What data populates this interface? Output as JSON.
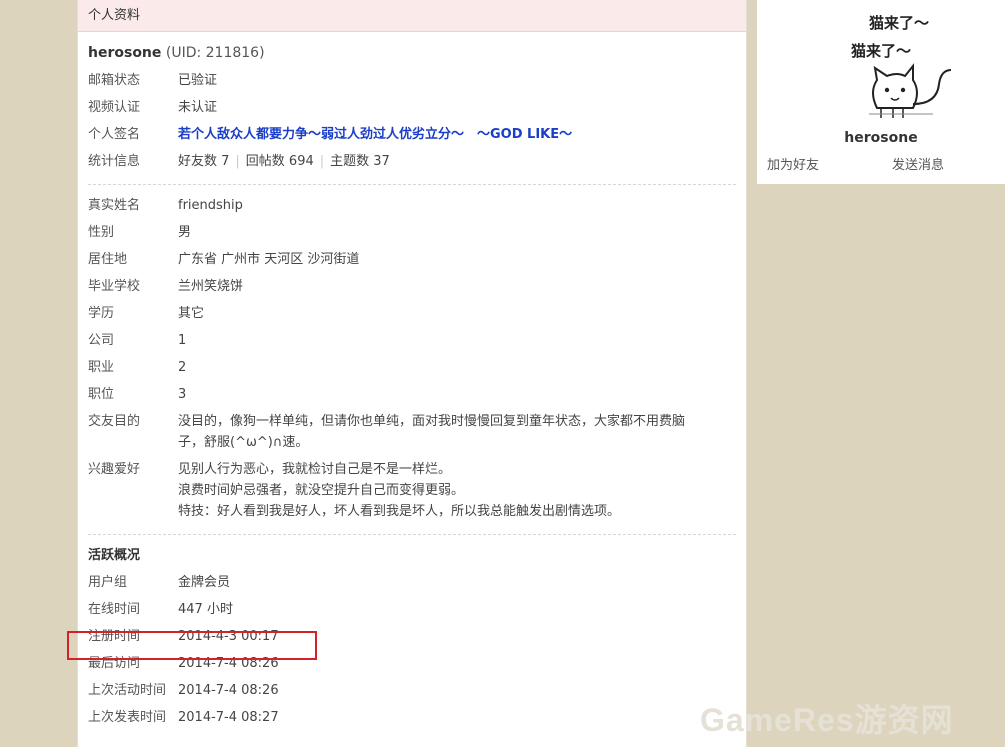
{
  "header": {
    "title": "个人资料"
  },
  "user": {
    "name": "herosone",
    "uid": "(UID: 211816)"
  },
  "basic": [
    {
      "label": "邮箱状态",
      "value": "已验证"
    },
    {
      "label": "视频认证",
      "value": "未认证"
    }
  ],
  "signature": {
    "label": "个人签名",
    "value": "若个人敌众人都要力争～弱过人劲过人优劣立分～　～GOD LIKE～"
  },
  "stats": {
    "label": "统计信息",
    "friends": "好友数 7",
    "replies": "回帖数 694",
    "topics": "主题数 37",
    "sep": "|"
  },
  "profile": [
    {
      "label": "真实姓名",
      "value": "friendship"
    },
    {
      "label": "性别",
      "value": "男"
    },
    {
      "label": "居住地",
      "value": "广东省 广州市 天河区 沙河街道"
    },
    {
      "label": "毕业学校",
      "value": "兰州笑烧饼"
    },
    {
      "label": "学历",
      "value": "其它"
    },
    {
      "label": "公司",
      "value": "1"
    },
    {
      "label": "职业",
      "value": "2"
    },
    {
      "label": "职位",
      "value": "3"
    }
  ],
  "purpose": {
    "label": "交友目的",
    "line1": "没目的，像狗一样单纯，但请你也单纯，面对我时慢慢回复到童年状态，大家都不用费脑",
    "line2": "子，舒服(^ω^)∩速。"
  },
  "hobby": {
    "label": "兴趣爱好",
    "line1": "见别人行为恶心，我就检讨自己是不是一样烂。",
    "line2": "浪费时间妒忌强者，就没空提升自己而变得更弱。",
    "line3": "特技：好人看到我是好人，坏人看到我是坏人，所以我总能触发出剧情选项。"
  },
  "activity": {
    "title": "活跃概况",
    "rows": [
      {
        "label": "用户组",
        "value": "金牌会员"
      },
      {
        "label": "在线时间",
        "value": "447 小时"
      },
      {
        "label": "注册时间",
        "value": "2014-4-3 00:17"
      },
      {
        "label": "最后访问",
        "value": "2014-7-4 08:26"
      },
      {
        "label": "上次活动时间",
        "value": "2014-7-4 08:26"
      },
      {
        "label": "上次发表时间",
        "value": "2014-7-4 08:27"
      }
    ]
  },
  "sidebar": {
    "avatar_text1": "猫来了～",
    "avatar_text2": "猫来了～",
    "name": "herosone",
    "add_friend": "加为好友",
    "send_message": "发送消息"
  },
  "watermark": "GameRes游资网",
  "colors": {
    "header_bg": "#fbeaea",
    "signature": "#1a3ec7",
    "highlight": "#d2232a",
    "page_bg": "#ddd4bd"
  }
}
